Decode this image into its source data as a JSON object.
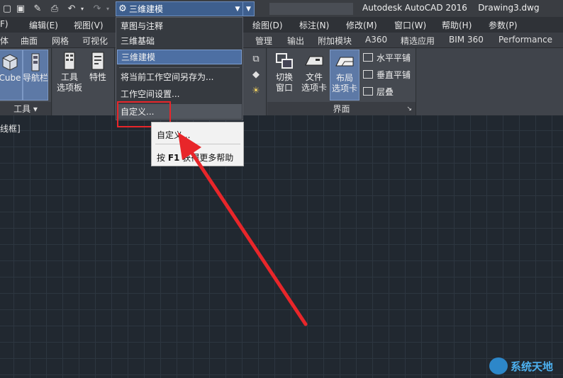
{
  "app": {
    "title": "Autodesk AutoCAD 2016",
    "document": "Drawing3.dwg"
  },
  "quick_access": {
    "icons": [
      "new-icon",
      "save-icon",
      "saveas-icon",
      "print-icon",
      "undo-icon",
      "redo-icon"
    ]
  },
  "workspace": {
    "current": "三维建模",
    "options": [
      "草图与注释",
      "三维基础",
      "三维建模"
    ],
    "save_as": "将当前工作空间另存为...",
    "settings": "工作空间设置...",
    "customize": "自定义..."
  },
  "menu_bar": [
    {
      "label": "文件(F)",
      "shown": "F)"
    },
    {
      "label": "编辑(E)"
    },
    {
      "label": "视图(V)"
    },
    {
      "label": "绘图(D)"
    },
    {
      "label": "标注(N)"
    },
    {
      "label": "修改(M)"
    },
    {
      "label": "窗口(W)"
    },
    {
      "label": "帮助(H)"
    },
    {
      "label": "参数(P)"
    }
  ],
  "ribbon_tabs": [
    "体",
    "曲面",
    "网格",
    "可视化",
    "管理",
    "输出",
    "附加模块",
    "A360",
    "精选应用",
    "BIM 360",
    "Performance"
  ],
  "ribbon": {
    "left_panel": {
      "buttons": [
        {
          "label": "Cube"
        },
        {
          "label": "导航栏"
        },
        {
          "label": "工具",
          "label2": "选项板"
        },
        {
          "label": "特性"
        }
      ],
      "footer": "工具"
    },
    "interface_panel": {
      "buttons": [
        {
          "label": "切换",
          "label2": "窗口"
        },
        {
          "label": "文件",
          "label2": "选项卡"
        },
        {
          "label": "布局",
          "label2": "选项卡"
        }
      ],
      "small_buttons": [
        "水平平铺",
        "垂直平铺",
        "层叠"
      ],
      "footer": "界面"
    }
  },
  "viewport_label": "线框]",
  "tooltip": {
    "title": "自定义...",
    "help_prefix": "按",
    "help_key": "F1",
    "help_text": "获得更多帮助"
  },
  "annotations": {
    "highlight_color": "#e8262a",
    "arrow_color": "#e8262a"
  },
  "watermark": "系统天地",
  "colors": {
    "canvas_bg": "#212830",
    "grid": "#2d3640",
    "selection": "#4d6fa3"
  }
}
